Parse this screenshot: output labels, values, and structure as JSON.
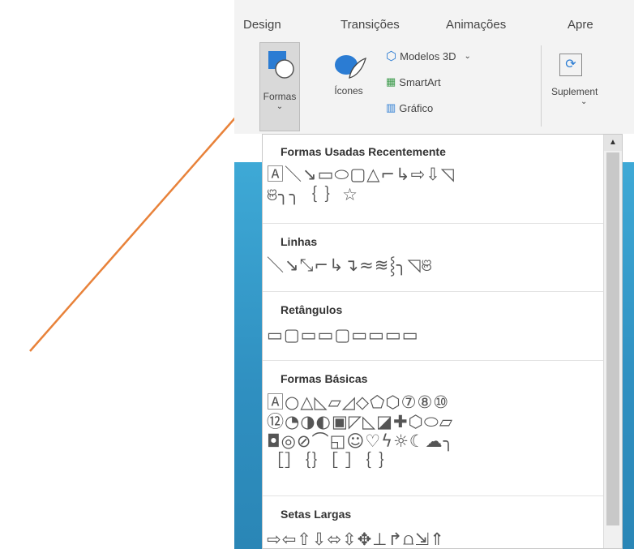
{
  "ribbon": {
    "tabs": [
      "Design",
      "Transições",
      "Animações",
      "Apre"
    ],
    "buttons": {
      "formas_label": "Formas",
      "icones_label": "Ícones",
      "modelos_label": "Modelos 3D",
      "smartart_label": "SmartArt",
      "grafico_label": "Gráfico",
      "suplementos_label": "Suplement"
    }
  },
  "menu": {
    "sections": [
      {
        "title": "Formas Usadas Recentemente",
        "rows": [
          "🄰＼↘▭⬭▢△⌐↳⇨⇩◹",
          "ଞ╮╮｛ ｝☆"
        ]
      },
      {
        "title": "Linhas",
        "rows": [
          "＼↘⤡⌐↳↴≈≋⸾╮◹ଞ"
        ]
      },
      {
        "title": "Retângulos",
        "rows": [
          "▭▢▭▭▢▭▭▭▭"
        ]
      },
      {
        "title": "Formas Básicas",
        "rows": [
          "🄰○△◺▱◿◇⬠⬡⑦⑧⑩",
          "⑫◔◑◐▣◸◺◪✚⬡⬭▱",
          "◘◎⊘⌒◱☺♡ϟ☼☾☁╮",
          "［］｛｝［ ］｛ ｝"
        ]
      },
      {
        "title": "Setas Largas",
        "rows": [
          "⇨⇦⇧⇩⬄⇳✥⊥↱⩍⇲⇑"
        ]
      }
    ]
  },
  "colors": {
    "arrow": "#e8823a",
    "slide": "#3ea9d6"
  }
}
